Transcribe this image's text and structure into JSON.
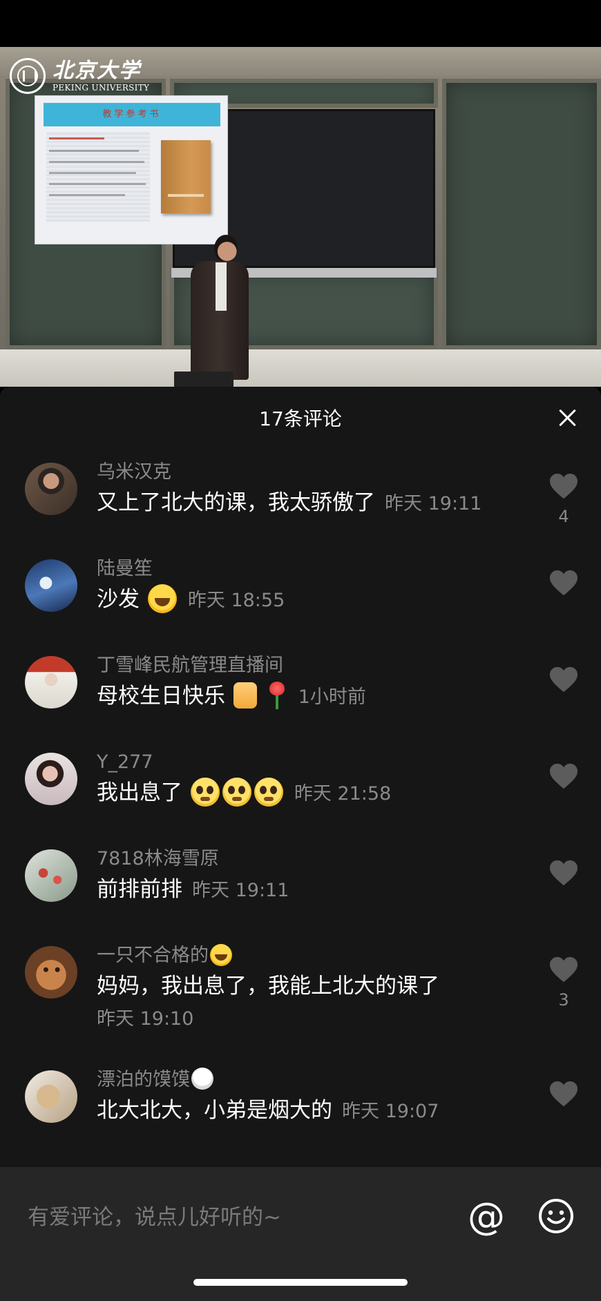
{
  "video": {
    "logo_cn": "北京大学",
    "logo_en": "PEKING UNIVERSITY",
    "slide_title": "教学参考书"
  },
  "panel": {
    "title": "17条评论"
  },
  "comments": [
    {
      "username": "乌米汉克",
      "text": "又上了北大的课，我太骄傲了",
      "time": "昨天 19:11",
      "likes": "4",
      "avatar_color": "#5a4a3c"
    },
    {
      "username": "陆曼笙",
      "text": "沙发",
      "emoji": [
        "laugh-cry-emoji"
      ],
      "time": "昨天 18:55",
      "likes": "",
      "avatar_color": "#2d4f86"
    },
    {
      "username": "丁雪峰民航管理直播间",
      "text": "母校生日快乐",
      "emoji": [
        "thumbs-up-emoji",
        "rose-emoji"
      ],
      "time": "1小时前",
      "likes": "",
      "avatar_color": "#c23b2a"
    },
    {
      "username": "Y_277",
      "text": "我出息了",
      "emoji": [
        "pleading-emoji",
        "pleading-emoji",
        "pleading-emoji"
      ],
      "time": "昨天 21:58",
      "likes": "",
      "avatar_color": "#d9c7c2"
    },
    {
      "username": "7818林海雪原",
      "text": "前排前排",
      "time": "昨天 19:11",
      "likes": "",
      "avatar_color": "#6a7a6a"
    },
    {
      "username": "一只不合格的",
      "username_emoji": "laugh-cry-emoji",
      "text": "妈妈，我出息了，我能上北大的课了",
      "time": "昨天 19:10",
      "likes": "3",
      "avatar_color": "#8a5a36"
    },
    {
      "username": "漂泊的馍馍",
      "username_emoji": "rice-bowl-emoji",
      "text": "北大北大，小弟是烟大的",
      "time": "昨天 19:07",
      "likes": "",
      "avatar_color": "#b89b7a"
    }
  ],
  "input": {
    "placeholder": "有爱评论，说点儿好听的~",
    "at_label": "@"
  },
  "colors": {
    "panel_bg": "#161616",
    "input_bg": "#262626",
    "muted_text": "#8a8a8a",
    "heart": "#5c5c5c"
  }
}
